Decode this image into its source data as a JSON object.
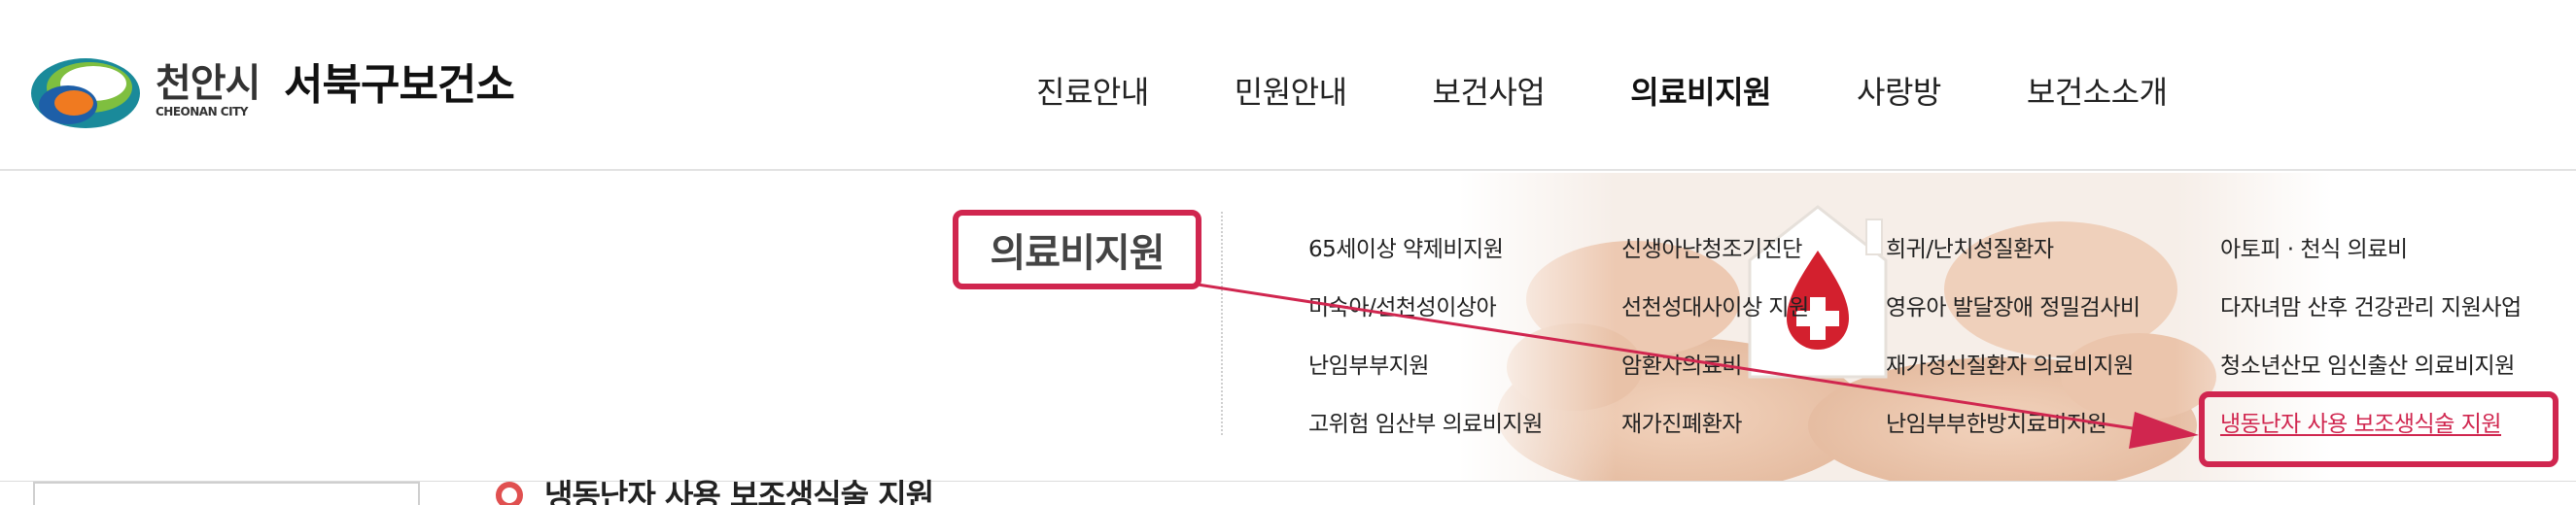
{
  "logo": {
    "city_ko": "천안시",
    "city_en": "CHEONAN CITY",
    "org": "서북구보건소"
  },
  "nav": [
    {
      "label": "진료안내",
      "active": false
    },
    {
      "label": "민원안내",
      "active": false
    },
    {
      "label": "보건사업",
      "active": false
    },
    {
      "label": "의료비지원",
      "active": true
    },
    {
      "label": "사랑방",
      "active": false
    },
    {
      "label": "보건소소개",
      "active": false
    }
  ],
  "mega_menu": {
    "title": "의료비지원",
    "columns": [
      [
        "65세이상 약제비지원",
        "미숙아/선천성이상아",
        "난임부부지원",
        "고위험 임산부 의료비지원"
      ],
      [
        "신생아난청조기진단",
        "선천성대사이상 지원",
        "암환자의료비",
        "재가진폐환자"
      ],
      [
        "희귀/난치성질환자",
        "영유아 발달장애 정밀검사비",
        "재가정신질환자 의료비지원",
        "난임부부한방치료비지원"
      ],
      [
        "아토피 · 천식 의료비",
        "다자녀맘 산후 건강관리 지원사업",
        "청소년산모 임신출산 의료비지원",
        "냉동난자 사용 보조생식술 지원"
      ]
    ],
    "selected_item": "냉동난자 사용 보조생식술 지원"
  },
  "content": {
    "heading": "냉동난자 사용 보조생식술 지원"
  },
  "colors": {
    "accent": "#d0264f",
    "heading_icon": "#e05050"
  }
}
